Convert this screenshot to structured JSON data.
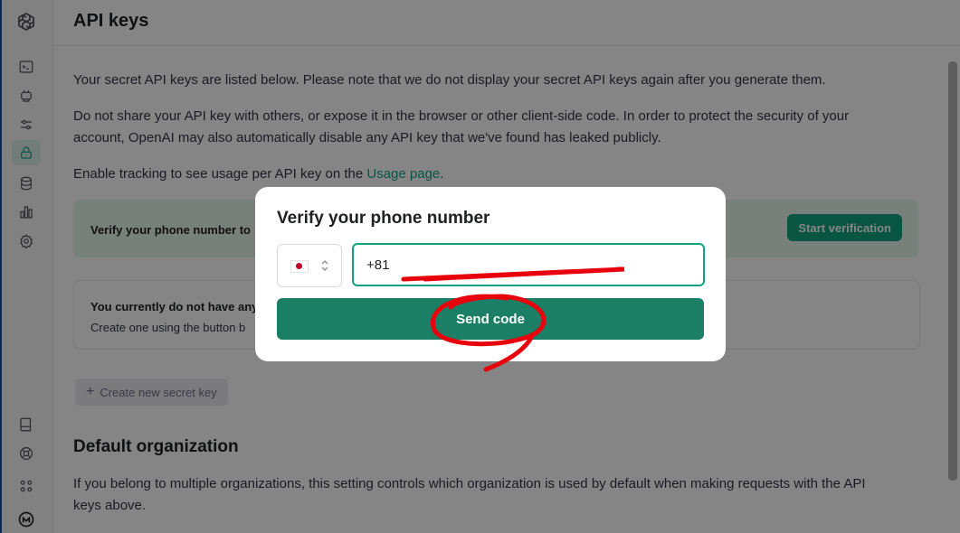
{
  "header": {
    "title": "API keys"
  },
  "main": {
    "para1": "Your secret API keys are listed below. Please note that we do not display your secret API keys again after you generate them.",
    "para2_line1": "Do not share your API key with others, or expose it in the browser or other client-side code. In order to protect the security of your",
    "para2_line2": "account, OpenAI may also automatically disable any API key that we've found has leaked publicly.",
    "para3_prefix": "Enable tracking to see usage per API key on the ",
    "para3_link": "Usage page",
    "para3_suffix": ".",
    "verify_banner_text": "Verify your phone number to",
    "start_verification": "Start verification",
    "empty_title": "You currently do not have any",
    "empty_desc": "Create one using the button b",
    "create_key_label": "Create new secret key",
    "default_org_heading": "Default organization",
    "default_org_line1": "If you belong to multiple organizations, this setting controls which organization is used by default when making requests with the API",
    "default_org_line2": "keys above."
  },
  "modal": {
    "title": "Verify your phone number",
    "phone_value": "+81",
    "send_label": "Send code"
  },
  "icons": {
    "sidebar_top": [
      "openai-logo-icon",
      "terminal-icon",
      "assistant-bot-icon",
      "sliders-icon",
      "lock-icon",
      "database-icon",
      "bar-chart-icon",
      "gear-icon"
    ],
    "sidebar_bottom": [
      "book-icon",
      "lifebuoy-icon",
      "apps-grid-icon",
      "avatar-icon"
    ]
  },
  "colors": {
    "accent": "#10a37f",
    "send_button": "#1a7f64",
    "annotation": "#e8000d"
  }
}
